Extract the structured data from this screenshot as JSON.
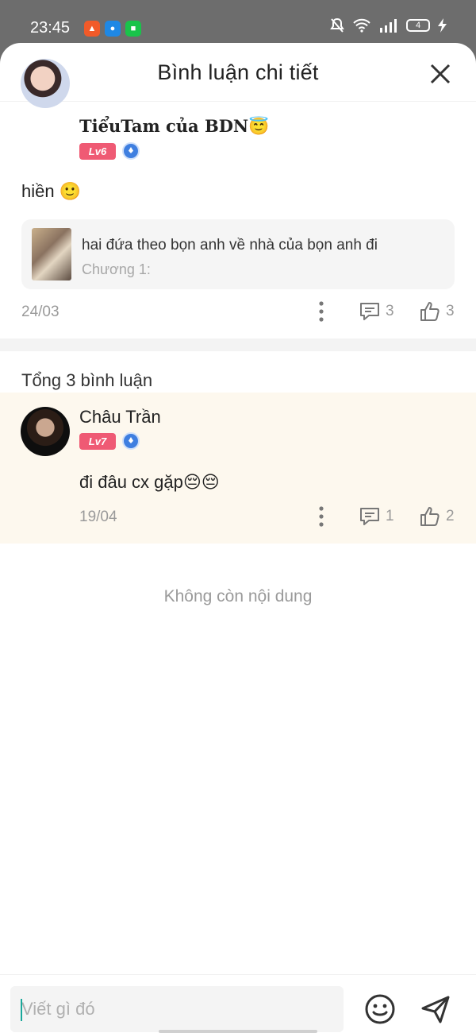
{
  "status_bar": {
    "time": "23:45",
    "battery": "4"
  },
  "header": {
    "title": "Bình luận chi tiết"
  },
  "main_comment": {
    "username": "TiểuTam của BDN",
    "username_emoji": "😇",
    "level": "Lv6",
    "text": "hiền",
    "text_emoji": "🙂",
    "quote": {
      "text": "hai đứa theo bọn anh về nhà của bọn anh đi",
      "chapter": "Chương 1:"
    },
    "date": "24/03",
    "reply_count": "3",
    "like_count": "3"
  },
  "replies_header": {
    "total_label": "Tổng 3 bình luận"
  },
  "replies": [
    {
      "username": "Châu Trần",
      "level": "Lv7",
      "text": "đi đâu cx gặp😔😔",
      "date": "19/04",
      "reply_count": "1",
      "like_count": "2"
    }
  ],
  "footer": {
    "end_text": "Không còn nội dung"
  },
  "input": {
    "placeholder": "Viết gì đó"
  },
  "colors": {
    "level_badge": "#ef5a74",
    "medal": "#3f7fe0",
    "highlight_row": "#fdf8ee",
    "caret": "#19a89b"
  },
  "icons": [
    "bell-off-icon",
    "wifi-icon",
    "signal-icon",
    "battery-icon",
    "charging-icon",
    "close-icon",
    "more-icon",
    "comment-icon",
    "like-icon",
    "emoji-icon",
    "send-icon"
  ]
}
